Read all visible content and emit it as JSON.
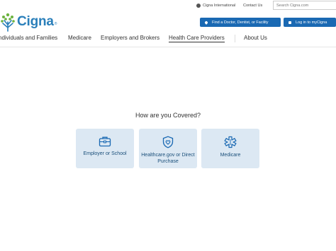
{
  "brand": {
    "name": "Cigna",
    "color": "#2a7fba"
  },
  "utility": {
    "international": "Cigna International",
    "contact": "Contact Us",
    "search_placeholder": "Search Cigna.com"
  },
  "actions": {
    "find": "Find a Doctor, Dentist, or Facility",
    "login": "Log in to myCigna",
    "button_color": "#1a69b3"
  },
  "nav": {
    "items": [
      "ndividuals and Families",
      "Medicare",
      "Employers and Brokers",
      "Health Care Providers",
      "About Us"
    ],
    "active": "Health Care Providers"
  },
  "main": {
    "title": "How are you Covered?",
    "cards": [
      {
        "label": "Employer or School",
        "icon": "briefcase-icon"
      },
      {
        "label": "Healthcare.gov or Direct Purchase",
        "icon": "shield-heart-icon"
      },
      {
        "label": "Medicare",
        "icon": "medical-star-icon"
      }
    ]
  }
}
